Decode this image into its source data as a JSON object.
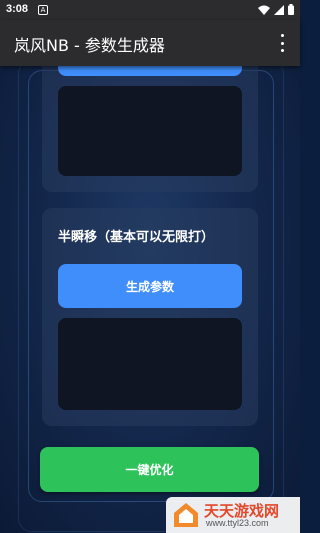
{
  "status_bar": {
    "time": "3:08"
  },
  "app_bar": {
    "title": "岚风NB - 参数生成器"
  },
  "section2": {
    "title": "半瞬移（基本可以无限打）",
    "button_label": "生成参数"
  },
  "footer": {
    "optimize_label": "一键优化"
  },
  "watermark": {
    "name": "天天游戏网",
    "url": "www.ttyl23.com"
  },
  "colors": {
    "accent_blue": "#3f8efc",
    "accent_green": "#2ec35a",
    "bar_bg": "#2c2c2e"
  },
  "icons": {
    "status": [
      "notification-icon",
      "wifi-icon",
      "signal-icon",
      "battery-icon"
    ],
    "menu": "more-vert-icon"
  }
}
